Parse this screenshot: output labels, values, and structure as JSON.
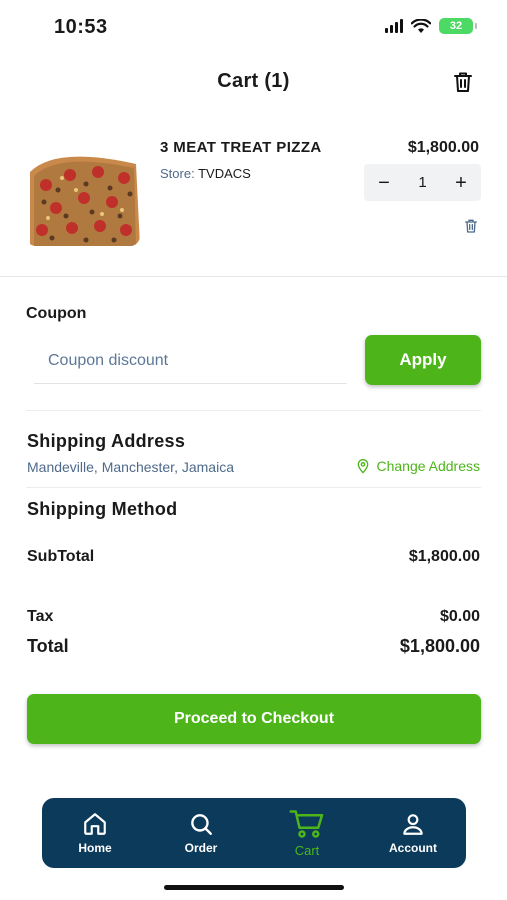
{
  "status": {
    "time": "10:53",
    "battery": "32"
  },
  "header": {
    "title": "Cart (1)"
  },
  "item": {
    "name": "3 MEAT TREAT PIZZA",
    "store_label": "Store:",
    "store_name": "TVDACS",
    "price": "$1,800.00",
    "quantity": "1",
    "minus": "−",
    "plus": "+"
  },
  "coupon": {
    "label": "Coupon",
    "placeholder": "Coupon discount",
    "apply_label": "Apply"
  },
  "shipping": {
    "title": "Shipping Address",
    "address": "Mandeville, Manchester, Jamaica",
    "change_label": "Change Address",
    "method_title": "Shipping Method"
  },
  "summary": {
    "subtotal_label": "SubTotal",
    "subtotal_value": "$1,800.00",
    "tax_label": "Tax",
    "tax_value": "$0.00",
    "total_label": "Total",
    "total_value": "$1,800.00"
  },
  "checkout": {
    "label": "Proceed to Checkout"
  },
  "tabs": [
    {
      "label": "Home",
      "icon": "home-icon"
    },
    {
      "label": "Order",
      "icon": "search-icon"
    },
    {
      "label": "Cart",
      "icon": "cart-icon",
      "active": true
    },
    {
      "label": "Account",
      "icon": "user-icon"
    }
  ],
  "colors": {
    "accent": "#4db51a",
    "navbar": "#0b3a5a",
    "muted_text": "#4e6a8a"
  }
}
